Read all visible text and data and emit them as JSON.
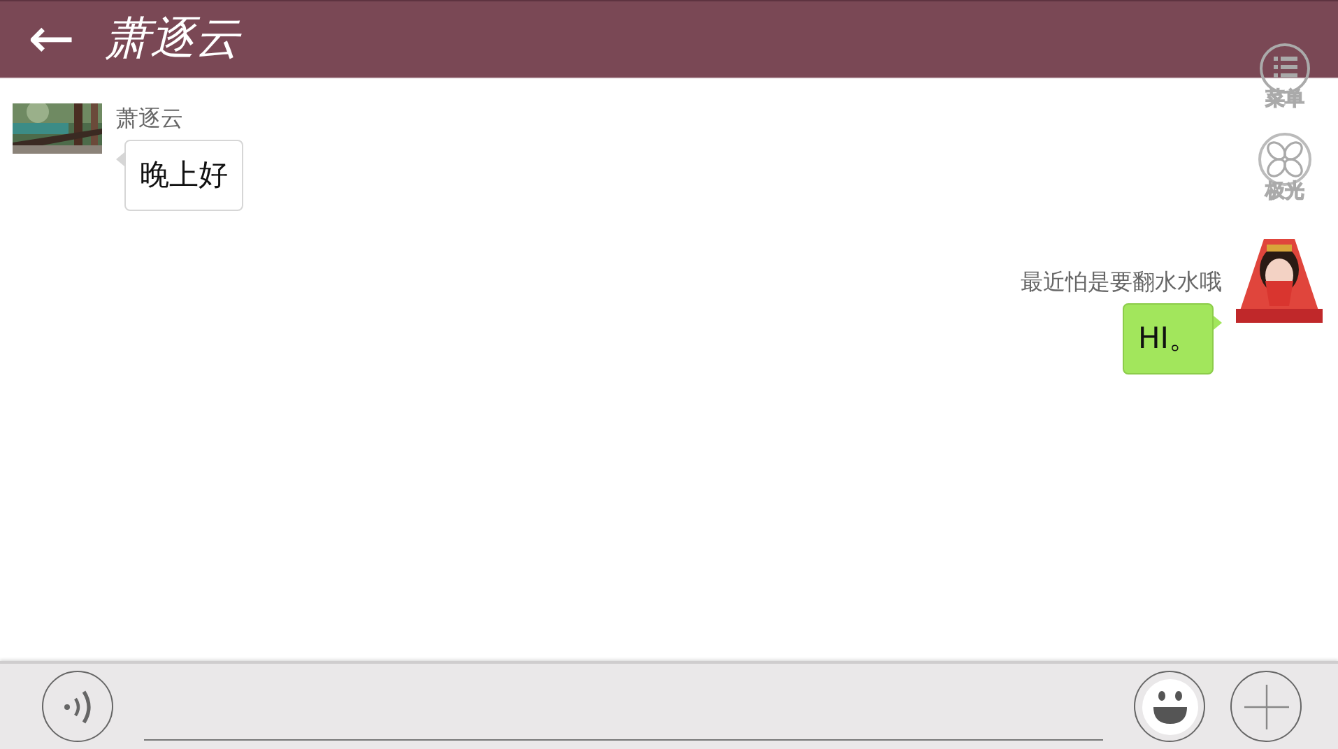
{
  "header": {
    "back_icon": "←",
    "title": "萧逐云"
  },
  "floating_buttons": [
    {
      "kind": "menu",
      "label": "菜单"
    },
    {
      "kind": "fan",
      "label": "极光"
    }
  ],
  "messages": [
    {
      "kind": "received",
      "sender": "萧逐云",
      "text": "晚上好"
    },
    {
      "kind": "sent",
      "sender": "最近怕是要翻水水哦",
      "text": "HI。"
    }
  ]
}
